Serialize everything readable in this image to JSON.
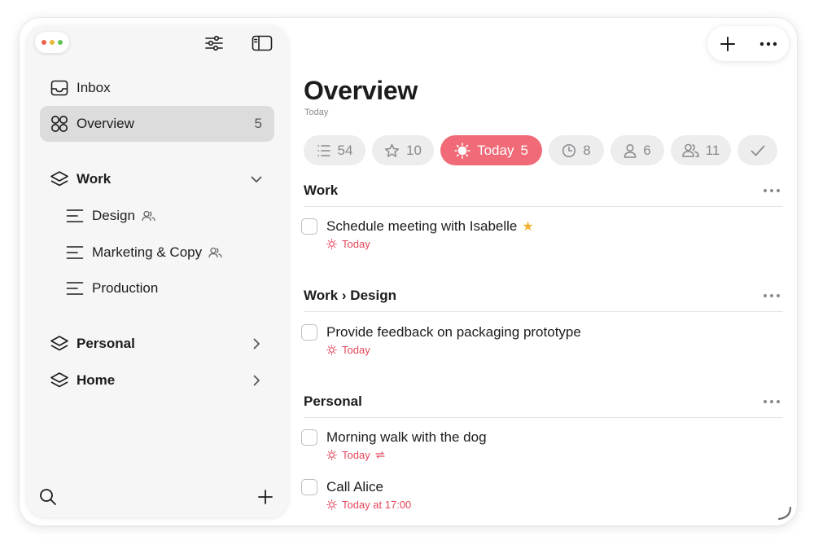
{
  "sidebar": {
    "toolbar": {
      "filter_icon": "sliders-icon",
      "toggle_icon": "sidebar-icon"
    },
    "inbox": {
      "label": "Inbox"
    },
    "overview": {
      "label": "Overview",
      "count": "5"
    },
    "groups": {
      "work": {
        "label": "Work",
        "lists": [
          {
            "label": "Design",
            "shared": true
          },
          {
            "label": "Marketing & Copy",
            "shared": true
          },
          {
            "label": "Production",
            "shared": false
          }
        ]
      },
      "personal": {
        "label": "Personal"
      },
      "home": {
        "label": "Home"
      }
    },
    "bottom": {
      "search_icon": "search-icon",
      "add_icon": "plus-icon"
    }
  },
  "header": {
    "title": "Overview",
    "subtitle": "Today"
  },
  "filters": [
    {
      "name": "all",
      "icon": "list-icon",
      "count": "54"
    },
    {
      "name": "starred",
      "icon": "star-icon",
      "count": "10"
    },
    {
      "name": "today",
      "icon": "sun-icon",
      "label": "Today",
      "count": "5",
      "active": true
    },
    {
      "name": "scheduled",
      "icon": "clock-icon",
      "count": "8"
    },
    {
      "name": "assigned",
      "icon": "person-icon",
      "count": "6"
    },
    {
      "name": "shared",
      "icon": "people-icon",
      "count": "11"
    },
    {
      "name": "completed",
      "icon": "checkmark-icon"
    }
  ],
  "sections": [
    {
      "title": "Work",
      "tasks": [
        {
          "title": "Schedule meeting with Isabelle",
          "starred": true,
          "meta": "Today"
        }
      ]
    },
    {
      "title": "Work › Design",
      "tasks": [
        {
          "title": "Provide feedback on packaging prototype",
          "meta": "Today"
        }
      ]
    },
    {
      "title": "Personal",
      "tasks": [
        {
          "title": "Morning walk with the dog",
          "meta": "Today",
          "repeat": true
        },
        {
          "title": "Call Alice",
          "meta": "Today at 17:00"
        }
      ]
    }
  ],
  "colors": {
    "accent": "#f06b77",
    "due_text": "#e4475b",
    "star": "#f4b12e",
    "traffic_red": "#e9634f",
    "traffic_yellow": "#e7b83a",
    "traffic_green": "#61c454"
  }
}
